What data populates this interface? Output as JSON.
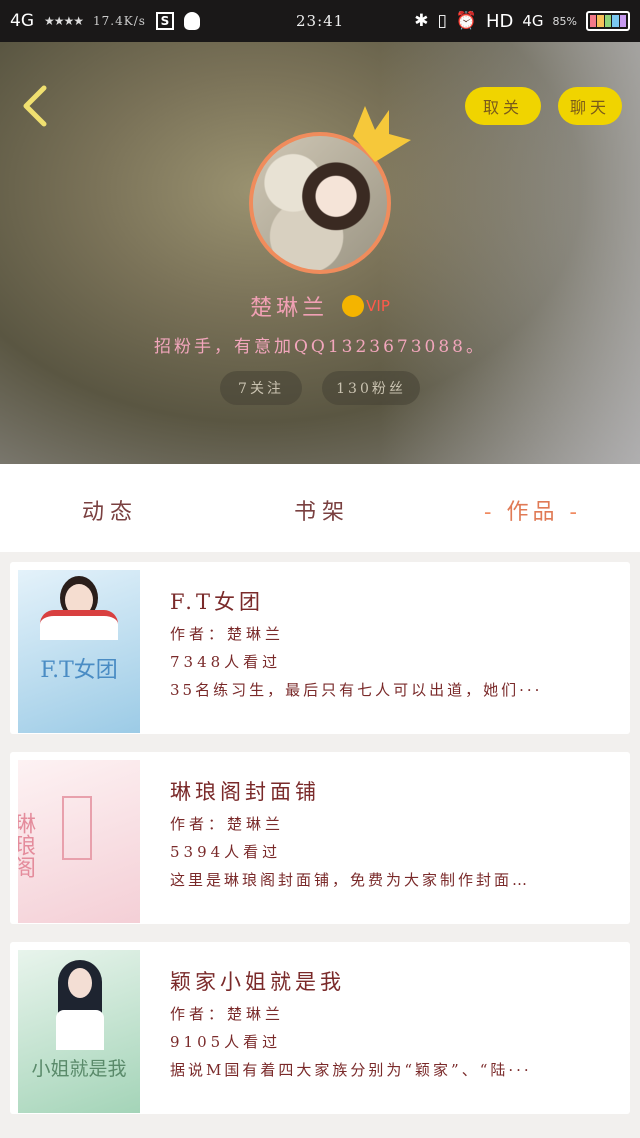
{
  "status_bar": {
    "network_left": "4G",
    "speed": "17.4K/s",
    "time": "23:41",
    "hd": "HD",
    "network_right": "4G",
    "battery_text": "85%"
  },
  "profile": {
    "follow_label": "取关",
    "chat_label": "聊天",
    "username": "楚琳兰",
    "vip_label": "VIP",
    "signature": "招粉手，有意加QQ1323673088。",
    "following": "7关注",
    "fans": "130粉丝"
  },
  "tabs": [
    {
      "label": "动态"
    },
    {
      "label": "书架"
    },
    {
      "label": "作品"
    }
  ],
  "tab_active_marker": "-",
  "books": [
    {
      "title": "F.T女团",
      "author": "作者：楚琳兰",
      "views": "7348人看过",
      "desc": "35名练习生，最后只有七人可以出道，她们···",
      "cover_text": "F.T女团",
      "cover_colors": [
        "#cfe6f3",
        "#7fb8da"
      ]
    },
    {
      "title": "琳琅阁封面铺",
      "author": "作者：楚琳兰",
      "views": "5394人看过",
      "desc": "这里是琳琅阁封面铺，免费为大家制作封面…",
      "cover_text": "琳琅阁",
      "cover_colors": [
        "#fbeaec",
        "#f2c4cc"
      ]
    },
    {
      "title": "颖家小姐就是我",
      "author": "作者：楚琳兰",
      "views": "9105人看过",
      "desc": "据说M国有着四大家族分别为“颖家”、“陆···",
      "cover_text": "小姐就是我",
      "cover_colors": [
        "#d8ece0",
        "#8cc4a4"
      ]
    }
  ]
}
